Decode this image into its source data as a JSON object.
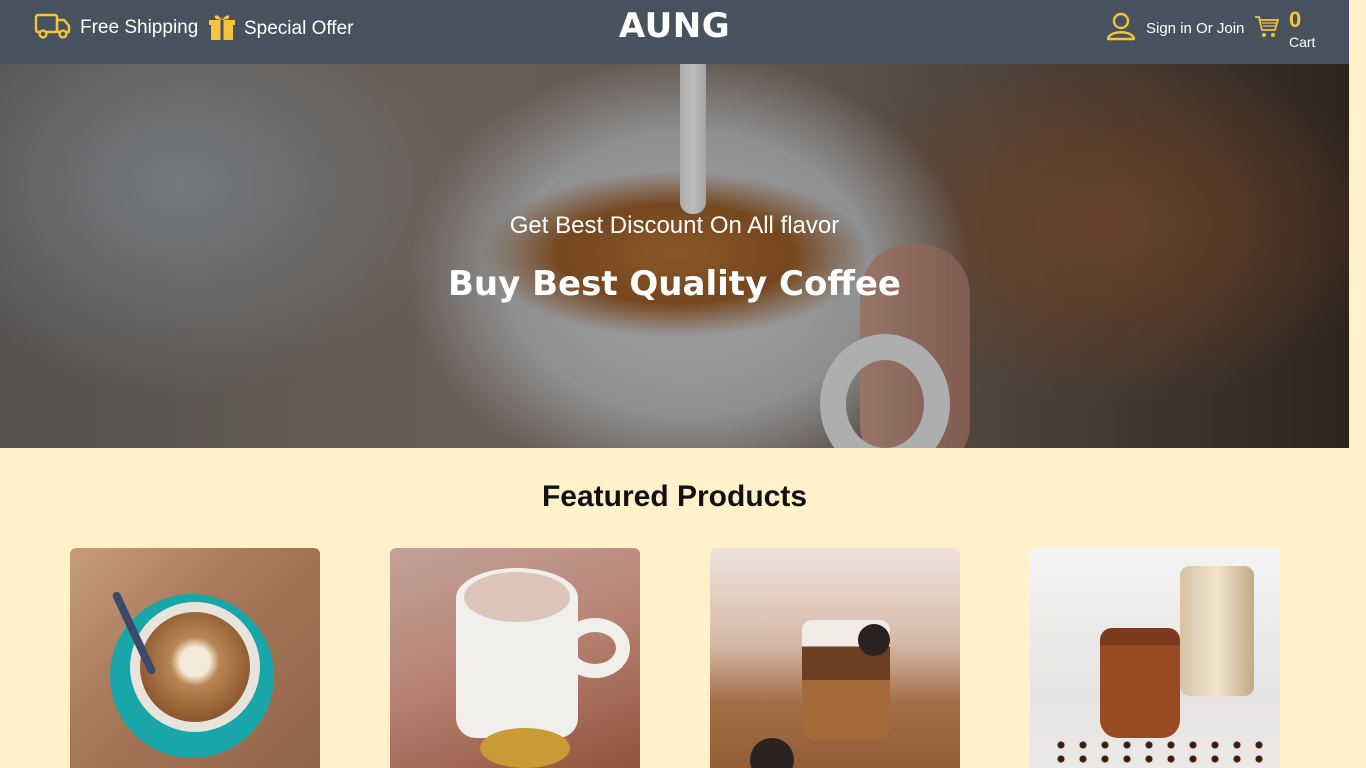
{
  "header": {
    "promos": [
      {
        "label": "Free Shipping",
        "icon": "truck-icon"
      },
      {
        "label": "Special Offer",
        "icon": "gift-icon"
      }
    ],
    "brand": "AUNG",
    "account_label": "Sign in Or Join",
    "cart": {
      "count": "0",
      "label": "Cart"
    },
    "accent_color": "#f3c43c",
    "bar_color": "#48525f"
  },
  "hero": {
    "subtitle": "Get Best Discount On All flavor",
    "title": "Buy Best Quality Coffee"
  },
  "featured": {
    "title": "Featured Products",
    "background_color": "#fff1c9"
  }
}
